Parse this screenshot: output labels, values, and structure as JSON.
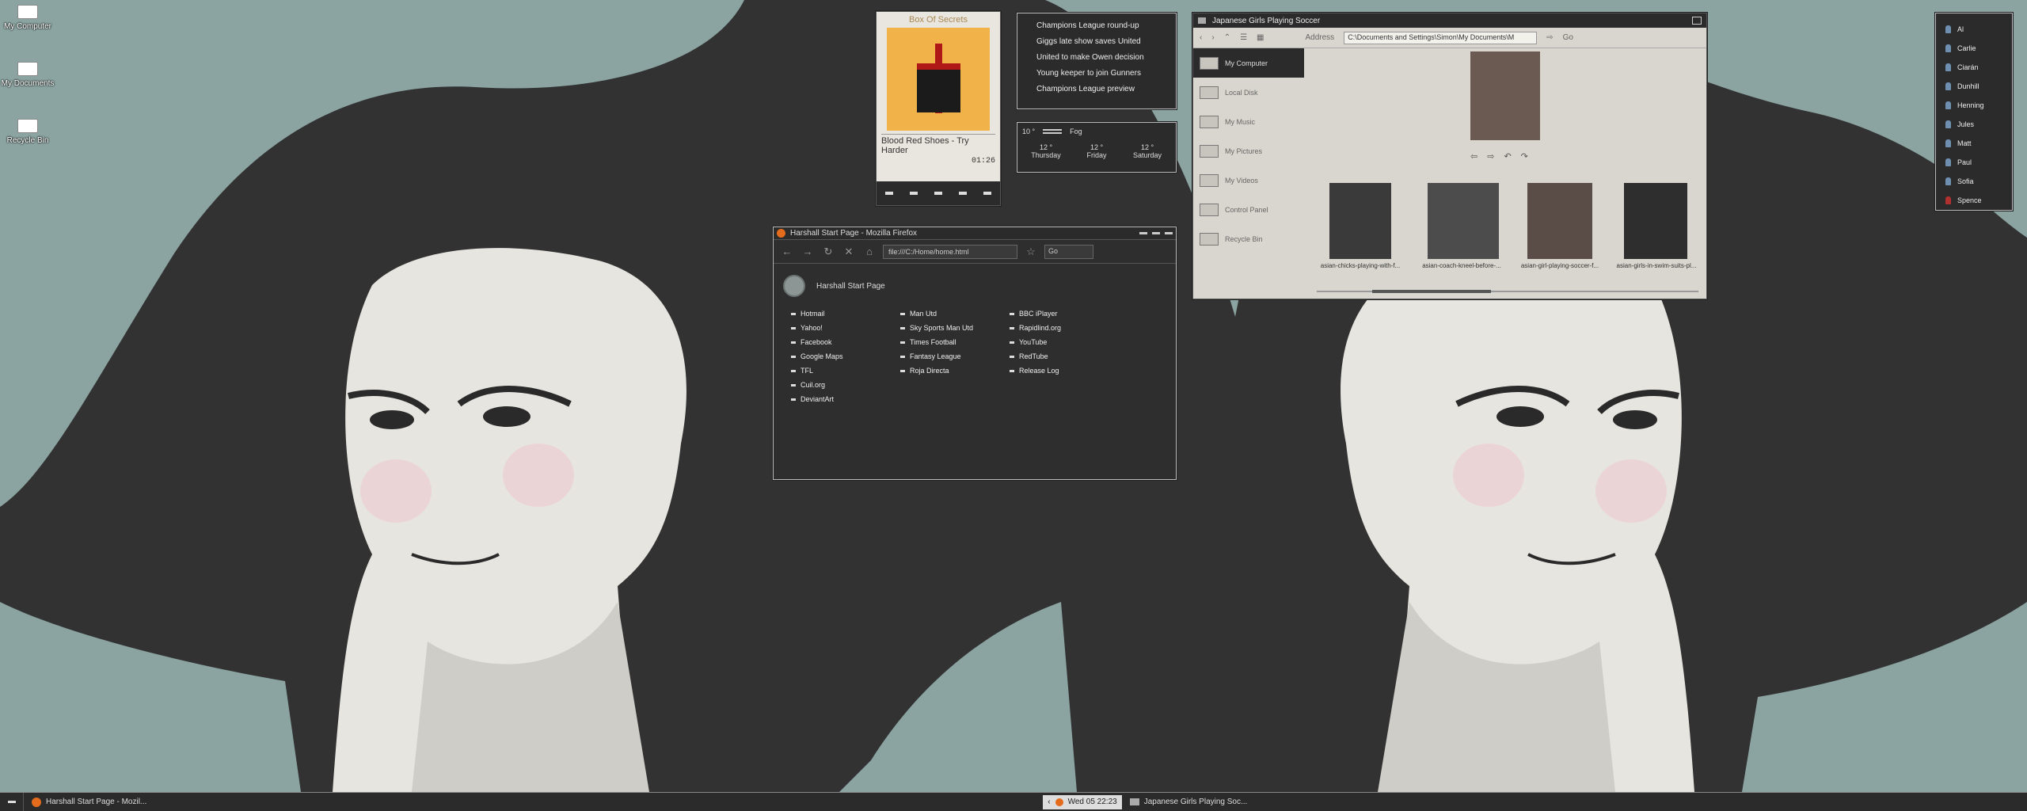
{
  "desktop": {
    "icons": [
      {
        "label": "My Computer",
        "icon": "computer-icon"
      },
      {
        "label": "My Documents",
        "icon": "documents-icon"
      },
      {
        "label": "Recycle Bin",
        "icon": "recycle-bin-icon"
      }
    ]
  },
  "music": {
    "album": "Box Of Secrets",
    "track": "Blood Red Shoes - Try Harder",
    "time": "01:26"
  },
  "news": {
    "items": [
      "Champions League round-up",
      "Giggs late show saves United",
      "United to make Owen decision",
      "Young keeper to join Gunners",
      "Champions League preview"
    ]
  },
  "weather": {
    "now_temp": "10 °",
    "now_cond": "Fog",
    "forecast": [
      {
        "temp": "12 °",
        "day": "Thursday"
      },
      {
        "temp": "12 °",
        "day": "Friday"
      },
      {
        "temp": "12 °",
        "day": "Saturday"
      }
    ]
  },
  "firefox": {
    "title": "Harshall Start Page - Mozilla Firefox",
    "url": "file:///C:/Home/home.html",
    "search_text": "Go",
    "page_title": "Harshall Start Page",
    "col1": [
      "Hotmail",
      "Yahoo!",
      "Facebook",
      "Google Maps",
      "TFL",
      "Cuil.org",
      "DeviantArt"
    ],
    "col2": [
      "Man Utd",
      "Sky Sports Man Utd",
      "Times Football",
      "Fantasy League",
      "Roja Directa"
    ],
    "col3": [
      "BBC iPlayer",
      "Rapidlind.org",
      "YouTube",
      "RedTube",
      "Release Log"
    ]
  },
  "explorer": {
    "title": "Japanese Girls Playing Soccer",
    "address_label": "Address",
    "address": "C:\\Documents and Settings\\Simon\\My Documents\\M",
    "go": "Go",
    "sidebar": [
      "My Computer",
      "Local Disk",
      "My Music",
      "My Pictures",
      "My Videos",
      "Control Panel",
      "Recycle Bin"
    ],
    "thumbs": [
      "asian-chicks-playing-with-f...",
      "asian-coach-kneel-before-...",
      "asian-girl-playing-soccer-f...",
      "asian-girls-in-swim-suits-pl..."
    ]
  },
  "contacts": [
    "Al",
    "Carlie",
    "Ciarán",
    "Dunhill",
    "Henning",
    "Jules",
    "Matt",
    "Paul",
    "Sofia",
    "Spence"
  ],
  "taskbar": {
    "task1": "Harshall Start Page - Mozil...",
    "clock": "Wed 05 22:23",
    "task2": "Japanese Girls Playing Soc..."
  },
  "colors": {
    "wallpaper_teal": "#8ba4a1",
    "wallpaper_dark": "#323232",
    "skin": "#e7e5e0"
  }
}
